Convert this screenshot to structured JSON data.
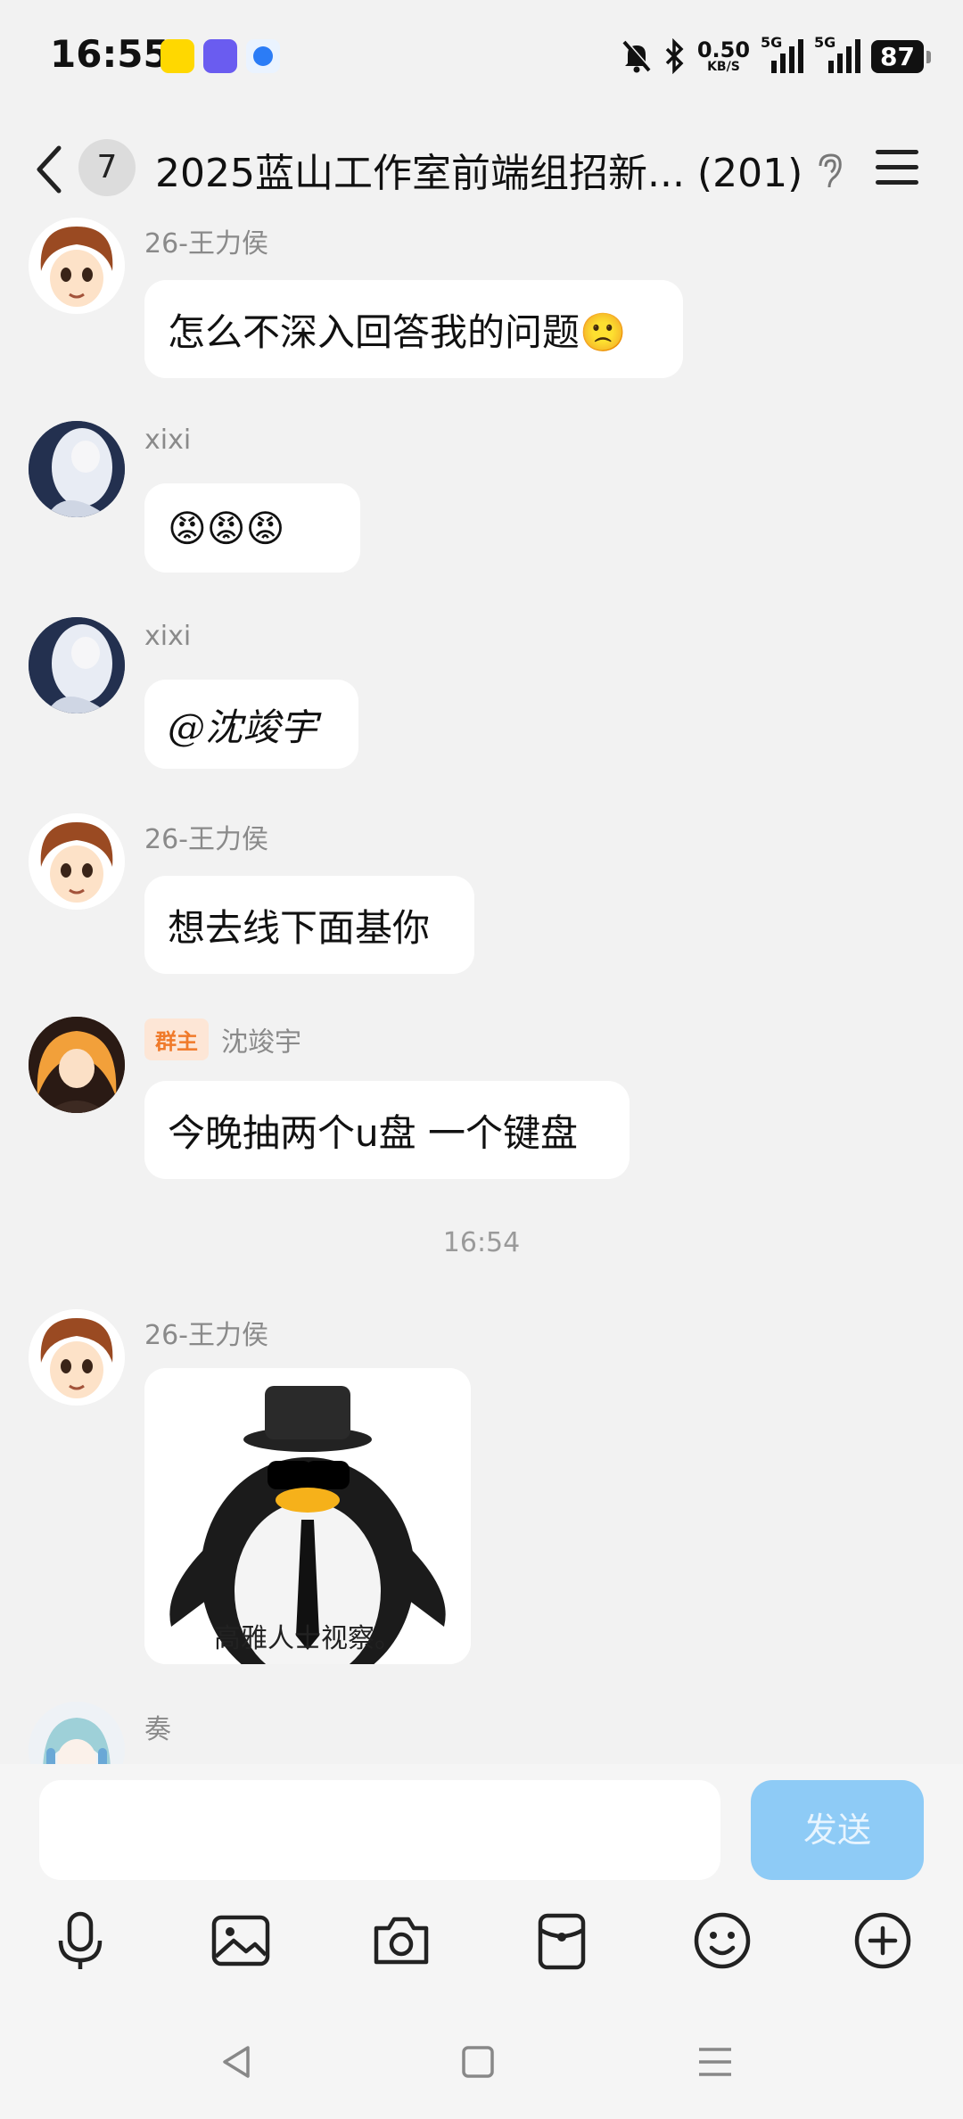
{
  "status_bar": {
    "time": "16:55",
    "net_speed_value": "0.50",
    "net_speed_unit": "KB/S",
    "signal1_label": "5G",
    "signal2_label": "5G",
    "battery": "87"
  },
  "header": {
    "unread_count": "7",
    "title": "2025蓝山工作室前端组招新... (201)"
  },
  "messages": [
    {
      "sender": "26-王力侯",
      "text": "怎么不深入回答我的问题🙁"
    },
    {
      "sender": "xixi",
      "text": "😡😡😡"
    },
    {
      "sender": "xixi",
      "text": "@沈竣宇"
    },
    {
      "sender": "26-王力侯",
      "text": "想去线下面基你"
    },
    {
      "badge": "群主",
      "sender": "沈竣宇",
      "text": "今晚抽两个u盘 一个键盘"
    },
    {
      "sender": "26-王力侯",
      "sticker_caption": "高雅人士视察。"
    },
    {
      "sender": "奏"
    }
  ],
  "timestamp": "16:54",
  "input": {
    "value": "",
    "send_label": "发送"
  },
  "toolbar": [
    "mic-icon",
    "image-icon",
    "camera-icon",
    "red-packet-icon",
    "emoji-icon",
    "plus-icon"
  ],
  "colors": {
    "send_button": "#8ecbf6",
    "background": "#f2f2f2",
    "badge_text": "#f07a2a",
    "badge_bg": "#fde6d6"
  }
}
